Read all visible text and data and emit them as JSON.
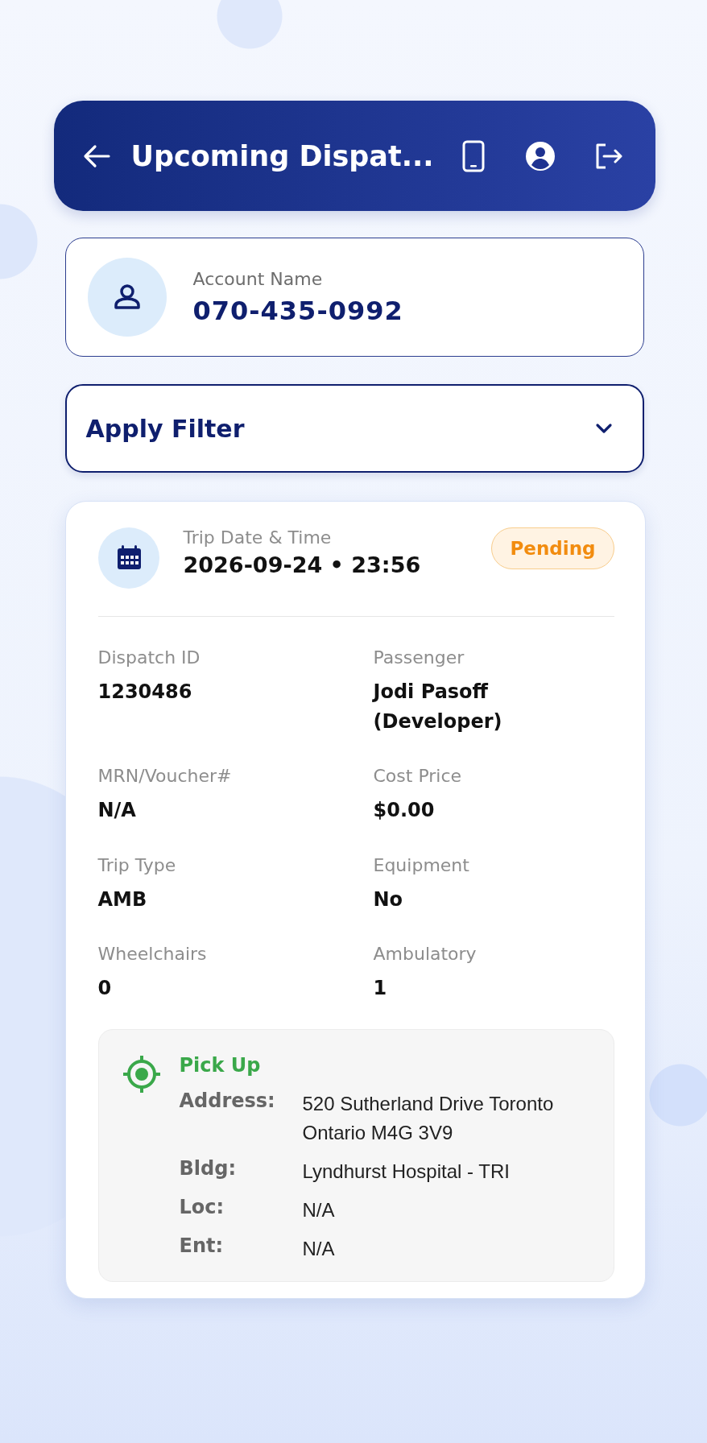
{
  "header": {
    "title": "Upcoming Dispat..."
  },
  "account": {
    "label": "Account Name",
    "value": "070-435-0992"
  },
  "filter": {
    "label": "Apply Filter",
    "expanded": false
  },
  "trip": {
    "date_label": "Trip Date & Time",
    "date_value": "2026-09-24 • 23:56",
    "status": "Pending",
    "fields": [
      {
        "label": "Dispatch ID",
        "value": "1230486"
      },
      {
        "label": "Passenger",
        "value": "Jodi Pasoff (Developer)"
      },
      {
        "label": "MRN/Voucher#",
        "value": "N/A"
      },
      {
        "label": "Cost Price",
        "value": "$0.00"
      },
      {
        "label": "Trip Type",
        "value": "AMB"
      },
      {
        "label": "Equipment",
        "value": "No"
      },
      {
        "label": "Wheelchairs",
        "value": "0"
      },
      {
        "label": "Ambulatory",
        "value": "1"
      }
    ],
    "pickup": {
      "title": "Pick Up",
      "rows": [
        {
          "label": "Address:",
          "value": "520 Sutherland Drive Toronto Ontario M4G 3V9"
        },
        {
          "label": "Bldg:",
          "value": "Lyndhurst Hospital - TRI"
        },
        {
          "label": "Loc:",
          "value": "N/A"
        },
        {
          "label": "Ent:",
          "value": "N/A"
        }
      ]
    }
  }
}
